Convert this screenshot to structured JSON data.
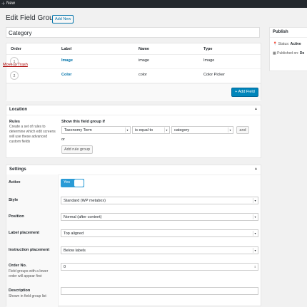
{
  "adminbar": {
    "plus": "+",
    "new_label": "New"
  },
  "header": {
    "title": "Edit Field Group",
    "add_new": "Add New"
  },
  "title_value": "Category",
  "fields_table": {
    "columns": [
      "Order",
      "Label",
      "Name",
      "Type"
    ],
    "rows": [
      {
        "order": "1",
        "label": "Image",
        "name": "image",
        "type": "Image"
      },
      {
        "order": "2",
        "label": "Color",
        "name": "color",
        "type": "Color Picker"
      }
    ],
    "add_field": "+ Add Field"
  },
  "location": {
    "title": "Location",
    "rules_label": "Rules",
    "rules_desc": "Create a set of rules to determine which edit screens will use these advanced custom fields",
    "show_if": "Show this field group if",
    "param": "Taxonomy Term",
    "operator": "is equal to",
    "value": "category",
    "and": "and",
    "or": "or",
    "add_rule_group": "Add rule group"
  },
  "settings": {
    "title": "Settings",
    "active_label": "Active",
    "active_value": "Yes",
    "style_label": "Style",
    "style_value": "Standard (WP metabox)",
    "position_label": "Position",
    "position_value": "Normal (after content)",
    "label_placement_label": "Label placement",
    "label_placement_value": "Top aligned",
    "instruction_label": "Instruction placement",
    "instruction_value": "Below labels",
    "order_label": "Order No.",
    "order_desc": "Field groups with a lower order will appear first",
    "order_value": "0",
    "description_label": "Description",
    "description_desc": "Shown in field group list",
    "description_value": ""
  },
  "publish": {
    "title": "Publish",
    "status_label": "Status:",
    "status_value": "Active",
    "published_label": "Published on:",
    "published_value": "De",
    "trash": "Move to Trash"
  },
  "colors": {
    "accent": "#0073aa",
    "primary_button": "#0085ba",
    "toggle": "#2a9bd6",
    "trash": "#a00"
  }
}
